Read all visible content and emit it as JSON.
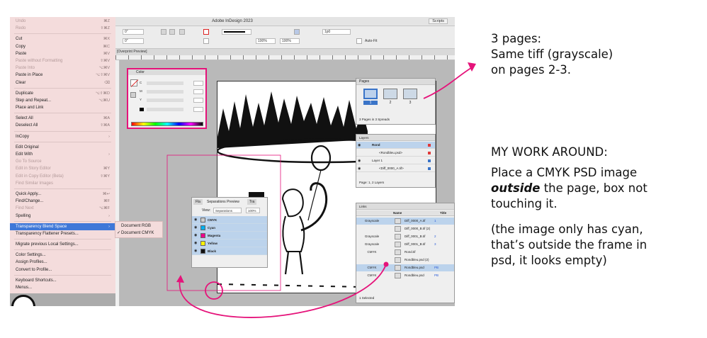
{
  "app": {
    "title": "Adobe InDesign 2023",
    "scripts_tab": "Scripts",
    "doc_tab": "[Overprint Preview]"
  },
  "control": {
    "x": "0\"",
    "y": "0\"",
    "zoom_w": "100%",
    "zoom_h": "100%",
    "stroke": "1p0",
    "rot": "0°",
    "shear": "0°",
    "autofit": "Auto-Fit"
  },
  "menu": {
    "items": [
      {
        "label": "Undo",
        "shortcut": "⌘Z",
        "disabled": true
      },
      {
        "label": "Redo",
        "shortcut": "⇧⌘Z",
        "disabled": true
      },
      {
        "sep": true
      },
      {
        "label": "Cut",
        "shortcut": "⌘X"
      },
      {
        "label": "Copy",
        "shortcut": "⌘C"
      },
      {
        "label": "Paste",
        "shortcut": "⌘V"
      },
      {
        "label": "Paste without Formatting",
        "shortcut": "⇧⌘V",
        "disabled": true
      },
      {
        "label": "Paste Into",
        "shortcut": "⌥⌘V",
        "disabled": true
      },
      {
        "label": "Paste in Place",
        "shortcut": "⌥⇧⌘V"
      },
      {
        "label": "Clear",
        "shortcut": "⌫"
      },
      {
        "sep": true
      },
      {
        "label": "Duplicate",
        "shortcut": "⌥⇧⌘D"
      },
      {
        "label": "Step and Repeat...",
        "shortcut": "⌥⌘U"
      },
      {
        "label": "Place and Link",
        "shortcut": ""
      },
      {
        "sep": true
      },
      {
        "label": "Select All",
        "shortcut": "⌘A"
      },
      {
        "label": "Deselect All",
        "shortcut": "⇧⌘A"
      },
      {
        "sep": true
      },
      {
        "label": "InCopy",
        "shortcut": "›"
      },
      {
        "sep": true
      },
      {
        "label": "Edit Original",
        "shortcut": ""
      },
      {
        "label": "Edit With",
        "shortcut": "›"
      },
      {
        "label": "Go To Source",
        "shortcut": "",
        "disabled": true
      },
      {
        "label": "Edit in Story Editor",
        "shortcut": "⌘Y",
        "disabled": true
      },
      {
        "label": "Edit in Copy Editor (Beta)",
        "shortcut": "⇧⌘Y",
        "disabled": true
      },
      {
        "label": "Find Similar Images",
        "shortcut": "",
        "disabled": true
      },
      {
        "sep": true
      },
      {
        "label": "Quick Apply...",
        "shortcut": "⌘↩"
      },
      {
        "label": "Find/Change...",
        "shortcut": "⌘F"
      },
      {
        "label": "Find Next",
        "shortcut": "⌥⌘F",
        "disabled": true
      },
      {
        "label": "Spelling",
        "shortcut": "›"
      },
      {
        "sep": true
      },
      {
        "label": "Transparency Blend Space",
        "shortcut": "›",
        "selected": true
      },
      {
        "label": "Transparency Flattener Presets...",
        "shortcut": ""
      },
      {
        "sep": true
      },
      {
        "label": "Migrate previous Local Settings...",
        "shortcut": ""
      },
      {
        "sep": true
      },
      {
        "label": "Color Settings...",
        "shortcut": ""
      },
      {
        "label": "Assign Profiles...",
        "shortcut": ""
      },
      {
        "label": "Convert to Profile...",
        "shortcut": ""
      },
      {
        "sep": true
      },
      {
        "label": "Keyboard Shortcuts...",
        "shortcut": ""
      },
      {
        "label": "Menus...",
        "shortcut": ""
      }
    ]
  },
  "submenu": {
    "items": [
      {
        "label": "Document RGB",
        "checked": false
      },
      {
        "label": "Document CMYK",
        "checked": true
      }
    ]
  },
  "color_panel": {
    "title": "Color",
    "channels": [
      "C",
      "M",
      "Y",
      "K"
    ]
  },
  "pages_panel": {
    "title": "Pages",
    "pages": [
      "1",
      "2",
      "3"
    ],
    "footer": "3 Pages in 3 Spreads"
  },
  "layers_panel": {
    "title": "Layers",
    "rows": [
      {
        "name": "Rond",
        "color": "#e03a3a",
        "header": true
      },
      {
        "name": "<Rondbleu.psd>",
        "color": "#e03a3a"
      },
      {
        "name": "Layer 1",
        "color": "#3a74c8",
        "header": true
      },
      {
        "name": "<Diff_0000_A.tif>",
        "color": "#3a74c8"
      }
    ],
    "footer": "Page: 1, 2 Layers"
  },
  "seps_panel": {
    "tabs": [
      "Fla",
      "Separations Preview",
      "Tra"
    ],
    "view_label": "View:",
    "view_value": "Separations",
    "pct": "100%",
    "rows": [
      {
        "name": "CMYK",
        "color": "#cccccc"
      },
      {
        "name": "Cyan",
        "color": "#00aeef"
      },
      {
        "name": "Magenta",
        "color": "#ec008c"
      },
      {
        "name": "Yellow",
        "color": "#fff200"
      },
      {
        "name": "Black",
        "color": "#111111"
      }
    ]
  },
  "links_panel": {
    "title": "Links",
    "col_name": "Name",
    "col_title": "Title",
    "rows": [
      {
        "space": "Grayscale",
        "name": "Diff_0000_A.tif",
        "page": "1",
        "sel": true
      },
      {
        "space": "",
        "name": "Diff_0000_B.tif (2)",
        "page": ""
      },
      {
        "space": "Grayscale",
        "name": "Diff_0001_B.tif",
        "page": "2"
      },
      {
        "space": "Grayscale",
        "name": "Diff_0001_B.tif",
        "page": "3"
      },
      {
        "space": "CMYK",
        "name": "Rond.tif",
        "page": ""
      },
      {
        "space": "",
        "name": "Rondbleu.psd (2)",
        "page": ""
      },
      {
        "space": "CMYK",
        "name": "Rondbleu.psd",
        "page": "PB",
        "sel": true
      },
      {
        "space": "CMYK",
        "name": "Rondbleu.psd",
        "page": "PB"
      }
    ],
    "footer": "1 Selected"
  },
  "annotations": {
    "p1": [
      "3 pages:",
      "Same tiff (grayscale)",
      "on pages 2-3."
    ],
    "heading": "MY WORK AROUND:",
    "p2a": "Place a CMYK PSD image",
    "p2b_em": "outside",
    "p2b_rest": " the page, box not",
    "p2c": "touching it.",
    "p3": [
      "(the image only has cyan,",
      "that’s outside the frame in",
      "psd, it looks empty)"
    ],
    "accent": "#e5137a"
  }
}
